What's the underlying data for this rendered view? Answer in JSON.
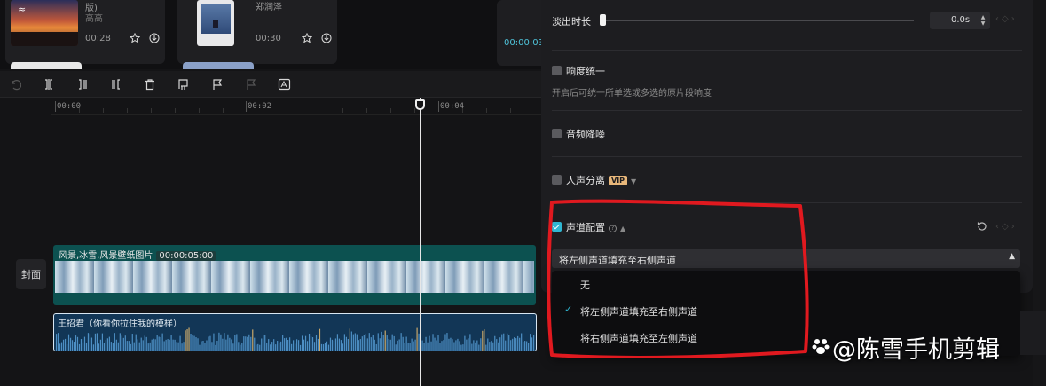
{
  "media": {
    "cards": [
      {
        "title": "版)",
        "artist": "高高",
        "duration": "00:28"
      },
      {
        "title": "郑润泽",
        "artist": "",
        "duration": "00:30"
      }
    ],
    "preview_time": "00:00:03"
  },
  "timeline": {
    "ticks": [
      "00:00",
      "00:02",
      "00:04"
    ],
    "cover_label": "封面",
    "video_clip": {
      "name": "风景,冰雪,风景壁纸图片",
      "duration": "00:00:05:00"
    },
    "audio_clip": {
      "name": "王招君（你看你拉住我的模样）"
    }
  },
  "props": {
    "fade_out_label": "淡出时长",
    "fade_out_value": "0.0s",
    "loudness_label": "响度统一",
    "loudness_desc": "开启后可统一所单选或多选的原片段响度",
    "denoise_label": "音频降噪",
    "vocal_sep_label": "人声分离",
    "vip_badge": "VIP",
    "channel_label": "声道配置",
    "channel_value": "将左侧声道填充至右侧声道",
    "channel_options": [
      "无",
      "将左侧声道填充至右侧声道",
      "将右侧声道填充至左侧声道"
    ],
    "selected_option_index": 1
  },
  "watermark": {
    "text": "@陈雪手机剪辑"
  },
  "colors": {
    "accent": "#2fb7d2",
    "annotation": "#e0191f",
    "video_track": "#0c5150",
    "audio_track": "#123656",
    "vip": "#e8b77a"
  }
}
